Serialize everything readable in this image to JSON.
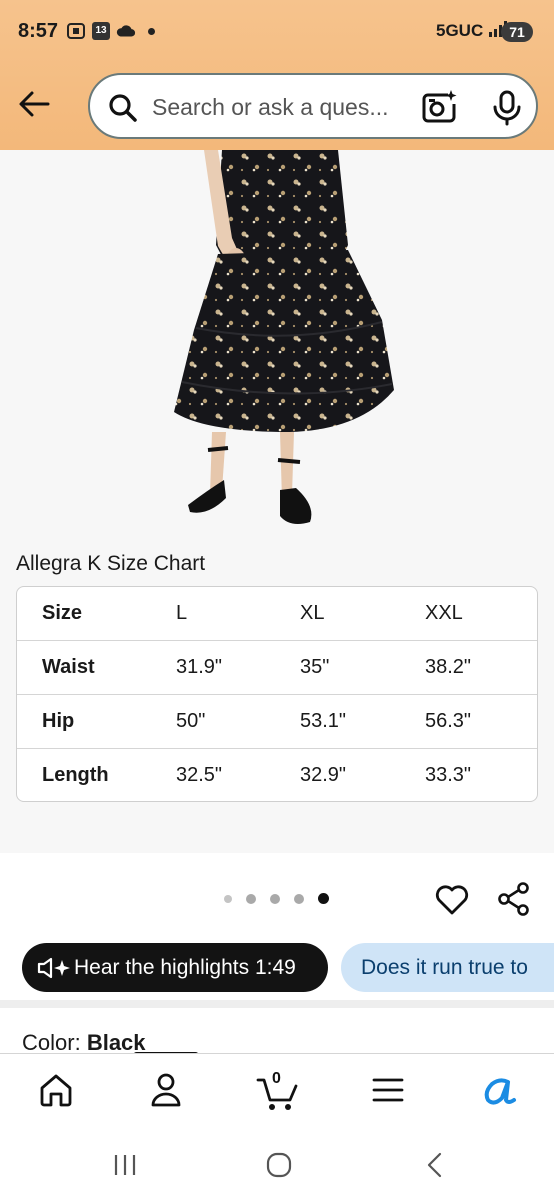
{
  "status_bar": {
    "time": "8:57",
    "calendar_day": "13",
    "network": "5GUC",
    "battery": "71"
  },
  "search": {
    "placeholder": "Search or ask a ques..."
  },
  "size_chart": {
    "title": "Allegra K Size Chart",
    "header": [
      "Size",
      "L",
      "XL",
      "XXL"
    ],
    "rows": [
      [
        "Waist",
        "31.9\"",
        "35\"",
        "38.2\""
      ],
      [
        "Hip",
        "50\"",
        "53.1\"",
        "56.3\""
      ],
      [
        "Length",
        "32.5\"",
        "32.9\"",
        "33.3\""
      ]
    ]
  },
  "gallery": {
    "image_count": 5,
    "active_index": 4
  },
  "pills": {
    "hear_highlights": "Hear the highlights 1:49",
    "question": "Does it run true to"
  },
  "color": {
    "label": "Color:",
    "value": "Black"
  },
  "bottom_nav": {
    "cart_count": "0",
    "items": [
      "home-icon",
      "account-icon",
      "cart-icon",
      "menu-icon",
      "rufus-icon"
    ]
  },
  "colors": {
    "header_bg": "#f3b87a",
    "dark_pill": "#131313",
    "light_pill": "#cfe4f7",
    "rufus_blue": "#1b8ce3"
  }
}
